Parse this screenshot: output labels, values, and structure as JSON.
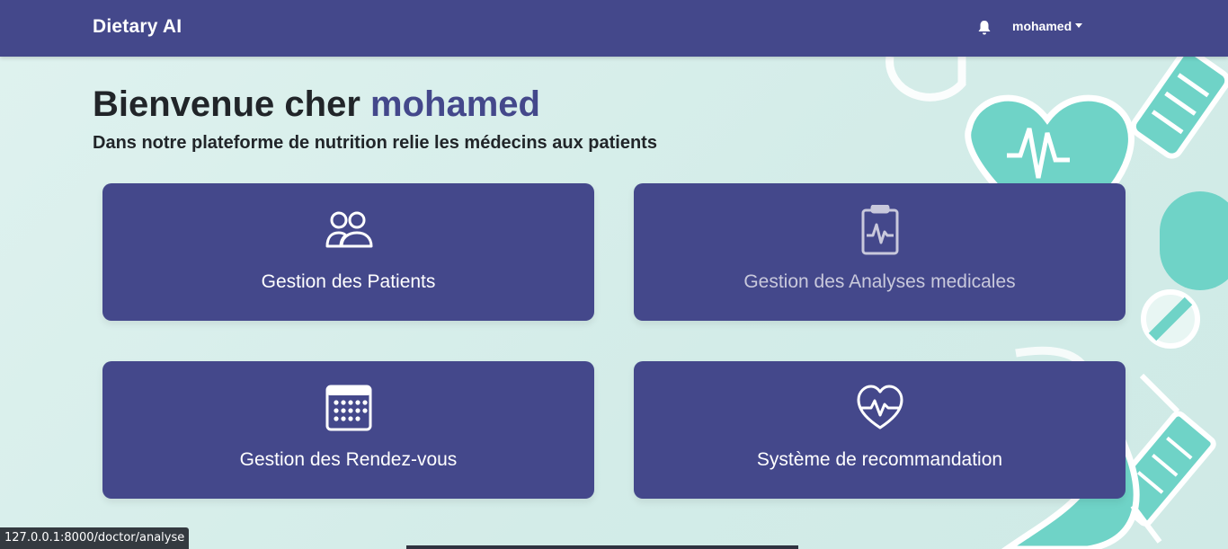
{
  "navbar": {
    "brand": "Dietary AI",
    "notification_icon": "bell-icon",
    "user_name": "mohamed"
  },
  "hero": {
    "greeting": "Bienvenue cher",
    "user_name": "mohamed",
    "subtitle": "Dans notre plateforme de nutrition relie les médecins aux patients"
  },
  "cards": [
    {
      "label": "Gestion des Patients",
      "icon": "users-icon"
    },
    {
      "label": "Gestion des Analyses medicales",
      "icon": "clipboard-pulse-icon"
    },
    {
      "label": "Gestion des Rendez-vous",
      "icon": "calendar-icon"
    },
    {
      "label": "Système de recommandation",
      "icon": "heart-pulse-icon"
    }
  ],
  "status": {
    "url": "127.0.0.1:8000/doctor/analyse"
  },
  "colors": {
    "primary": "#44488b",
    "background": "#d3ece8",
    "accent": "#6fd3c7"
  }
}
